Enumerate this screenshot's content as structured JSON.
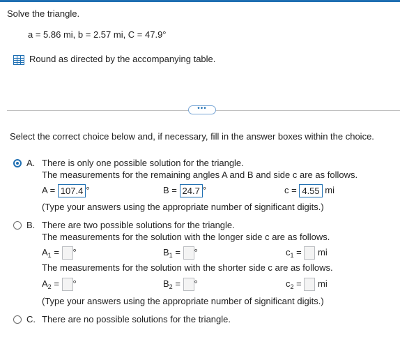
{
  "question": {
    "prompt": "Solve the triangle.",
    "given": "a = 5.86 mi, b = 2.57 mi, C = 47.9°",
    "round_note": "Round as directed by the accompanying table."
  },
  "more_button": "•••",
  "instruction": "Select the correct choice below and, if necessary, fill in the answer boxes within the choice.",
  "choices": {
    "a": {
      "letter": "A.",
      "line1": "There is only one possible solution for the triangle.",
      "line2": "The measurements for the remaining angles A and B and side c are as follows.",
      "A_label": "A =",
      "A_value": "107.4",
      "B_label": "B =",
      "B_value": "24.7",
      "c_label": "c =",
      "c_value": "4.55",
      "deg": "°",
      "unit": "mi",
      "note": "(Type your answers using the appropriate number of significant digits.)",
      "selected": true
    },
    "b": {
      "letter": "B.",
      "line1": "There are two possible solutions for the triangle.",
      "line2": "The measurements for the solution with the longer side c are as follows.",
      "line3": "The measurements for the solution with the shorter side c are as follows.",
      "A": "A",
      "B": "B",
      "c": "c",
      "sub1": "1",
      "sub2": "2",
      "eq": "=",
      "deg": "°",
      "unit": "mi",
      "note": "(Type your answers using the appropriate number of significant digits.)",
      "selected": false
    },
    "c": {
      "letter": "C.",
      "line1": "There are no possible solutions for the triangle.",
      "selected": false
    }
  }
}
